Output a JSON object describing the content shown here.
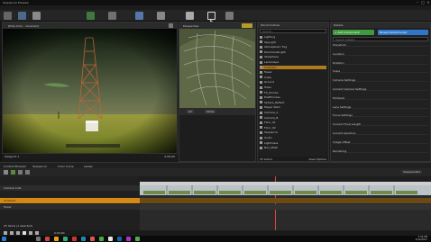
{
  "window": {
    "title": "Sequencer Preview",
    "controls": [
      "–",
      "□",
      "×"
    ]
  },
  "menu": [
    "File",
    "Edit",
    "Window",
    "Help"
  ],
  "toolbar_labels": [
    "Save",
    "Source",
    "Content",
    "Marketplace",
    "Settings",
    "Blueprints",
    "Cinematics",
    "Build",
    "Play",
    "Launch"
  ],
  "viewport": {
    "header": "[Pilot Actor - CineCam]",
    "footer_left": "Viewport 1",
    "footer_right": "0:00:00"
  },
  "mid_viewport": {
    "header": "Perspective",
    "buttons": [
      "Lit",
      "Show"
    ]
  },
  "outliner": {
    "title": "World Outliner",
    "search_placeholder": "Search...",
    "items": [
      "Lighting",
      "SkyLight",
      "Atmospheric Fog",
      "DirectionalLight",
      "SkySphere",
      "Landscape",
      "CineCam",
      "Tower",
      "Cube",
      "Ground",
      "Trees",
      "FX_Smoke",
      "PostProcess",
      "Sphere_Reflect",
      "Player Start",
      "Camera_A",
      "Camera_B",
      "Floor_01",
      "Floor_02",
      "Sequence",
      "Audio",
      "Lightmass",
      "Nav_Mesh"
    ],
    "footer": "25 actors",
    "view_options": "View Options"
  },
  "details": {
    "title": "Details",
    "add_component": "+ Add Component",
    "blueprint": "Blueprint/Add Script",
    "search_placeholder": "Search Details",
    "sections": [
      "Transform",
      "Location",
      "Rotation",
      "Scale",
      "Camera Settings",
      "Current Camera Settings",
      "Filmback",
      "Lens Settings",
      "Focus Settings",
      "Current Focal Length",
      "Current Aperture",
      "Image Offset",
      "Rendering"
    ]
  },
  "sequencer": {
    "tabs": [
      "Content Browser",
      "Sequencer",
      "Color Curve",
      "Levels"
    ],
    "sequence_name": "Sequence01",
    "tracks": [
      "Camera Cuts",
      "CineCam",
      "Tower"
    ],
    "footer": "25 items (1 selected)",
    "timecode": "0:00:00"
  },
  "taskbar": {
    "time": "2:34 PM",
    "date": "4/12/2017"
  }
}
